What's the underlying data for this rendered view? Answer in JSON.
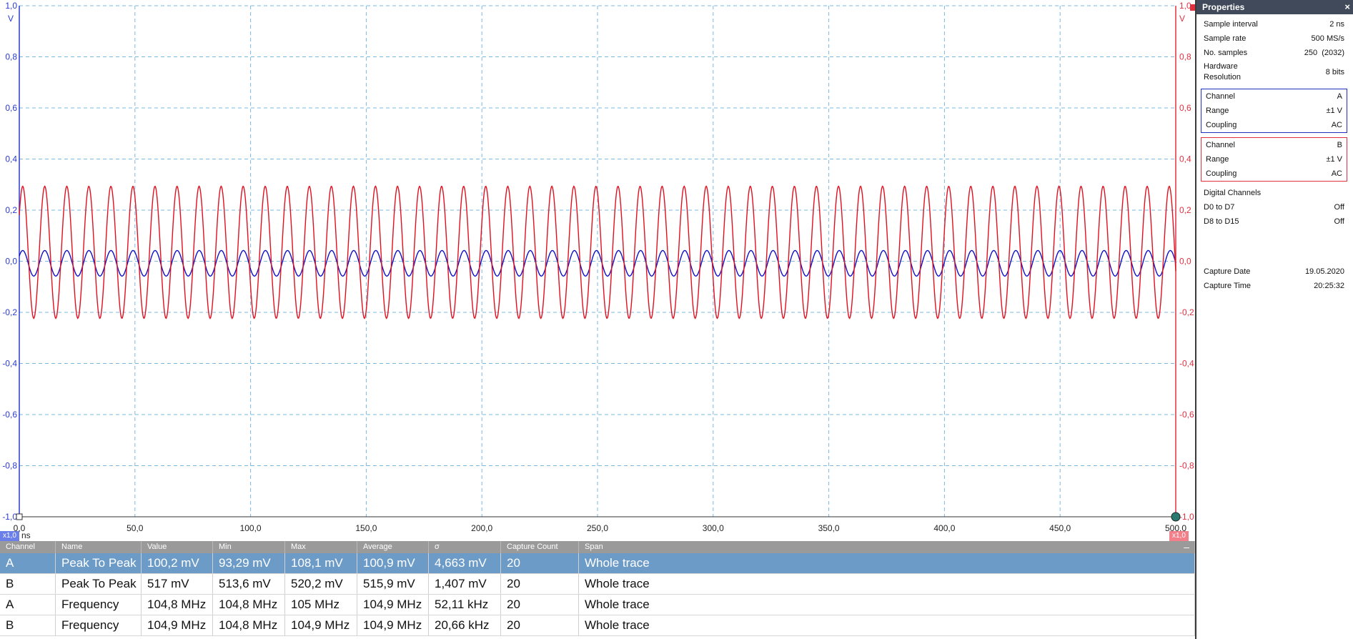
{
  "scope": {
    "x_unit": "ns",
    "y_unit_left": "V",
    "y_unit_right": "V",
    "x_ticks": [
      "0,0",
      "50,0",
      "100,0",
      "150,0",
      "200,0",
      "250,0",
      "300,0",
      "350,0",
      "400,0",
      "450,0",
      "500,0"
    ],
    "y_ticks_left": [
      "1,0",
      "0,8",
      "0,6",
      "0,4",
      "0,2",
      "0,0",
      "-0,2",
      "-0,4",
      "-0,6",
      "-0,8",
      "-1,0"
    ],
    "y_ticks_right": [
      "1,0",
      "0,8",
      "0,6",
      "0,4",
      "0,2",
      "0,0",
      "-0,2",
      "-0,4",
      "-0,6",
      "-0,8",
      "-1,0"
    ],
    "zoom_left": "x1,0",
    "zoom_right": "x1,0",
    "colors": {
      "channel_a": "#1010c8",
      "channel_b": "#e01020",
      "grid": "#7ab8e0",
      "left_axis": "#2a3ad0",
      "right_axis": "#e03040"
    }
  },
  "chart_data": {
    "type": "line",
    "x_range": [
      0,
      500
    ],
    "y_range": [
      -1,
      1
    ],
    "grid": true,
    "series": [
      {
        "name": "A",
        "frequency_mhz": 104.8,
        "peak_to_peak_mv": 100.2,
        "offset_v": -0.008,
        "color": "#1010c8"
      },
      {
        "name": "B",
        "frequency_mhz": 104.9,
        "peak_to_peak_mv": 517,
        "offset_v": 0.035,
        "color": "#e01020"
      }
    ]
  },
  "measurements": {
    "headers": [
      "Channel",
      "Name",
      "Value",
      "Min",
      "Max",
      "Average",
      "σ",
      "Capture Count",
      "Span"
    ],
    "rows": [
      [
        "A",
        "Peak To Peak",
        "100,2 mV",
        "93,29 mV",
        "108,1 mV",
        "100,9 mV",
        "4,663 mV",
        "20",
        "Whole trace"
      ],
      [
        "B",
        "Peak To Peak",
        "517 mV",
        "513,6 mV",
        "520,2 mV",
        "515,9 mV",
        "1,407 mV",
        "20",
        "Whole trace"
      ],
      [
        "A",
        "Frequency",
        "104,8 MHz",
        "104,8 MHz",
        "105 MHz",
        "104,9 MHz",
        "52,11 kHz",
        "20",
        "Whole trace"
      ],
      [
        "B",
        "Frequency",
        "104,9 MHz",
        "104,8 MHz",
        "104,9 MHz",
        "104,9 MHz",
        "20,66 kHz",
        "20",
        "Whole trace"
      ]
    ],
    "minimize_label": "–"
  },
  "properties": {
    "title": "Properties",
    "close_label": "×",
    "sample_interval": {
      "label": "Sample interval",
      "value": "2 ns"
    },
    "sample_rate": {
      "label": "Sample rate",
      "value": "500 MS/s"
    },
    "no_samples": {
      "label": "No. samples",
      "value": "250  (2032)"
    },
    "hw_res": {
      "label1": "Hardware",
      "label2": "Resolution",
      "value": "8 bits"
    },
    "channel_a": {
      "channel_label": "Channel",
      "channel": "A",
      "range_label": "Range",
      "range": "±1 V",
      "coupling_label": "Coupling",
      "coupling": "AC"
    },
    "channel_b": {
      "channel_label": "Channel",
      "channel": "B",
      "range_label": "Range",
      "range": "±1 V",
      "coupling_label": "Coupling",
      "coupling": "AC"
    },
    "digital": {
      "title": "Digital Channels",
      "d0_label": "D0 to D7",
      "d0_value": "Off",
      "d8_label": "D8 to D15",
      "d8_value": "Off"
    },
    "capture_date": {
      "label": "Capture Date",
      "value": "19.05.2020"
    },
    "capture_time": {
      "label": "Capture Time",
      "value": "20:25:32"
    }
  }
}
